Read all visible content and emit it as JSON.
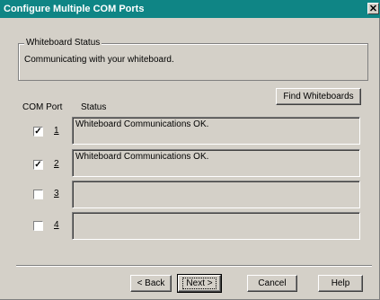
{
  "window": {
    "title": "Configure Multiple COM Ports",
    "close_glyph": "✕"
  },
  "whiteboard_status": {
    "group_title": "Whiteboard Status",
    "message": "Communicating with your whiteboard."
  },
  "find_button": {
    "label": "Find Whiteboards"
  },
  "headers": {
    "com_port": "COM Port",
    "status": "Status"
  },
  "rows": [
    {
      "checked": true,
      "check_glyph": "✓",
      "port": "1",
      "status": "Whiteboard Communications OK."
    },
    {
      "checked": true,
      "check_glyph": "✓",
      "port": "2",
      "status": "Whiteboard Communications OK."
    },
    {
      "checked": false,
      "check_glyph": "",
      "port": "3",
      "status": ""
    },
    {
      "checked": false,
      "check_glyph": "",
      "port": "4",
      "status": ""
    }
  ],
  "buttons": {
    "back": "< Back",
    "next": "Next >",
    "cancel": "Cancel",
    "help": "Help"
  },
  "colors": {
    "titlebar": "#0f8585",
    "face": "#d4d0c8"
  }
}
